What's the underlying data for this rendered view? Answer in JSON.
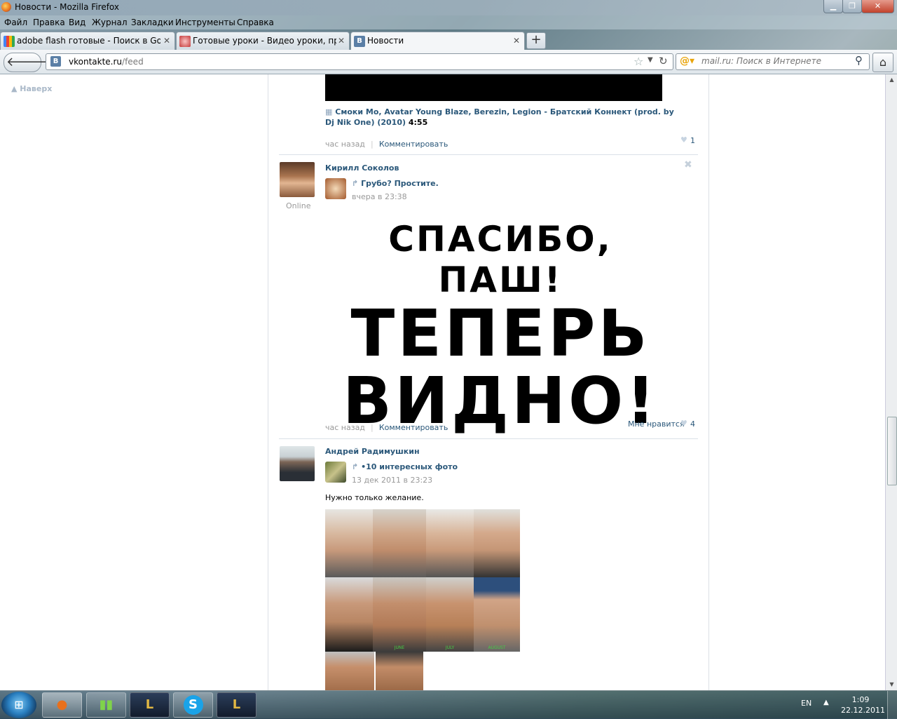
{
  "window": {
    "title": "Новости - Mozilla Firefox"
  },
  "menu": [
    "Файл",
    "Правка",
    "Вид",
    "Журнал",
    "Закладки",
    "Инструменты",
    "Справка"
  ],
  "tabs": [
    {
      "label": "adobe flash готовые - Поиск в Google",
      "icon": "google-icon"
    },
    {
      "label": "Готовые уроки - Видео уроки, прог...",
      "icon": "lessons-icon"
    },
    {
      "label": "Новости",
      "icon": "vk-icon"
    }
  ],
  "nav": {
    "url_host": "vkontakte.ru",
    "url_path": "/feed",
    "site_icon_letter": "B",
    "search_placeholder": "mail.ru: Поиск в Интернете"
  },
  "page": {
    "up_link": "Наверх",
    "post1": {
      "audio": "Смоки Мо, Avatar Young Blaze, Berezin, Legion - Братский Коннект (prod. by Dj Nik One) (2010)",
      "duration": "4:55",
      "time": "час назад",
      "comment": "Комментировать",
      "likes": "1"
    },
    "post2": {
      "author": "Кирилл Соколов",
      "status": "Online",
      "repost_title": "Грубо? Простите.",
      "repost_time": "вчера в 23:38",
      "image_lines": [
        "СПАСИБО, ПАШ!",
        "ТЕПЕРЬ",
        "ВИДНО!"
      ],
      "time": "час назад",
      "comment": "Комментировать",
      "like_label": "Мне нравится",
      "likes": "4"
    },
    "post3": {
      "author": "Андрей Радимушкин",
      "repost_title": "•10 интересных фото",
      "repost_time": "13 дек 2011 в 23:23",
      "text": "Нужно только желание.",
      "photo_labels": [
        "JUNE",
        "JULY",
        "AUGUST"
      ]
    }
  },
  "taskbar": {
    "lang": "EN",
    "time": "1:09",
    "date": "22.12.2011",
    "apps": [
      "firefox-icon",
      "winamp-icon",
      "league-icon",
      "skype-icon",
      "league-icon"
    ]
  }
}
